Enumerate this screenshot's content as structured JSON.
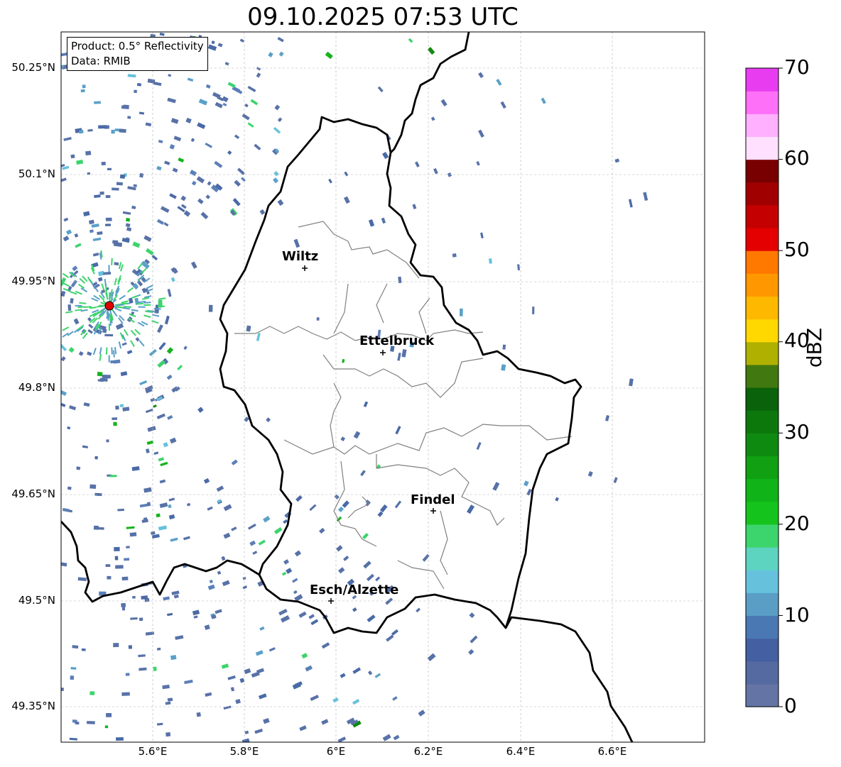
{
  "title": "09.10.2025 07:53 UTC",
  "info": {
    "product": "Product: 0.5° Reflectivity",
    "source": "Data: RMIB"
  },
  "y_ticks": [
    "50.25°N",
    "50.1°N",
    "49.95°N",
    "49.8°N",
    "49.65°N",
    "49.5°N",
    "49.35°N"
  ],
  "x_ticks": [
    "5.6°E",
    "5.8°E",
    "6°E",
    "6.2°E",
    "6.4°E",
    "6.6°E"
  ],
  "colorbar": {
    "label": "dBZ",
    "ticks": [
      "0",
      "10",
      "20",
      "30",
      "40",
      "50",
      "60",
      "70"
    ],
    "colors": [
      "#6474a4",
      "#546aa0",
      "#4460a2",
      "#4a78b2",
      "#5a9ec6",
      "#66c2dc",
      "#5cd4c0",
      "#3cd46c",
      "#14c41c",
      "#10b418",
      "#10a012",
      "#0e8a10",
      "#0c780c",
      "#0a620a",
      "#427810",
      "#b0b000",
      "#ffd800",
      "#ffb800",
      "#ff9800",
      "#ff7800",
      "#e40000",
      "#c40000",
      "#a00000",
      "#780000",
      "#ffe0ff",
      "#ffb0ff",
      "#ff70f8",
      "#e83cf0"
    ]
  },
  "cities": [
    {
      "name": "Wiltz"
    },
    {
      "name": "Ettelbruck"
    },
    {
      "name": "Findel"
    },
    {
      "name": "Esch/Alzette"
    }
  ],
  "radar_marker_color": "#e00000"
}
